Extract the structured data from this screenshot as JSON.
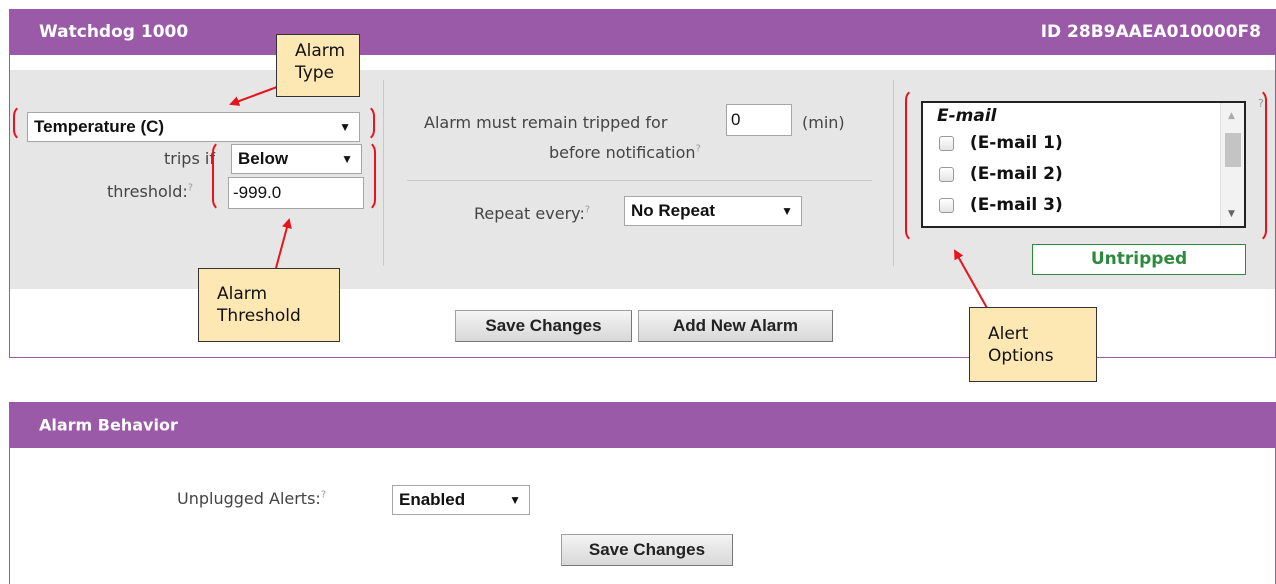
{
  "header": {
    "title": "Watchdog 1000",
    "device_id": "ID 28B9AAEA010000F8"
  },
  "alarm": {
    "type_select": "Temperature (C)",
    "trips_if_label": "trips if",
    "trips_if_value": "Below",
    "threshold_label": "threshold:",
    "threshold_value": "-999.0",
    "help_mark": "?",
    "tripped_prefix": "Alarm must remain tripped for",
    "tripped_minutes": "0",
    "tripped_unit": "(min)",
    "tripped_suffix": "before notification",
    "repeat_label": "Repeat every:",
    "repeat_value": "No Repeat",
    "alert_list": {
      "group_label": "E-mail",
      "items": [
        {
          "label": "(E-mail 1)",
          "checked": false
        },
        {
          "label": "(E-mail 2)",
          "checked": false
        },
        {
          "label": "(E-mail 3)",
          "checked": false
        }
      ]
    },
    "status": "Untripped",
    "save_button": "Save Changes",
    "add_button": "Add New Alarm"
  },
  "callouts": {
    "alarm_type": [
      "Alarm",
      "Type"
    ],
    "alarm_threshold": [
      "Alarm",
      "Threshold"
    ],
    "alert_options": [
      "Alert",
      "Options"
    ]
  },
  "behavior": {
    "title": "Alarm Behavior",
    "unplugged_label": "Unplugged Alerts:",
    "unplugged_value": "Enabled",
    "save_button": "Save Changes"
  },
  "colors": {
    "header_bg": "#9a5aa8",
    "status_green": "#2e8b3e",
    "annotation_red": "#e8141c",
    "callout_bg": "#fde8b4"
  }
}
